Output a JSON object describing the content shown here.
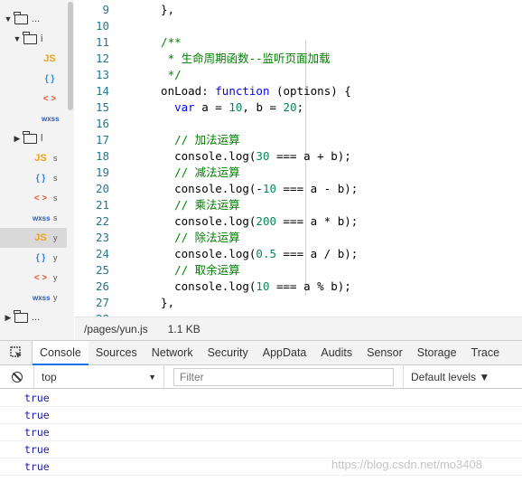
{
  "file_tree": {
    "rows": [
      {
        "arrow": "▼",
        "type": "folder",
        "name": "..."
      },
      {
        "arrow": "▼",
        "type": "folder",
        "name": "i"
      },
      {
        "type": "file",
        "icon": "JS",
        "icon_kind": "js",
        "name": ""
      },
      {
        "type": "file",
        "icon": "{ }",
        "icon_kind": "json",
        "name": ""
      },
      {
        "type": "file",
        "icon": "< >",
        "icon_kind": "wxml",
        "name": ""
      },
      {
        "type": "file",
        "icon": "wxss",
        "icon_kind": "wxss",
        "name": ""
      },
      {
        "arrow": "▶",
        "type": "folder",
        "name": "l"
      },
      {
        "type": "file",
        "icon": "JS",
        "icon_kind": "js",
        "name": "s"
      },
      {
        "type": "file",
        "icon": "{ }",
        "icon_kind": "json",
        "name": "s"
      },
      {
        "type": "file",
        "icon": "< >",
        "icon_kind": "wxml",
        "name": "s"
      },
      {
        "type": "file",
        "icon": "wxss",
        "icon_kind": "wxss",
        "name": "s"
      },
      {
        "type": "file",
        "icon": "JS",
        "icon_kind": "js",
        "name": "y",
        "selected": true
      },
      {
        "type": "file",
        "icon": "{ }",
        "icon_kind": "json",
        "name": "y"
      },
      {
        "type": "file",
        "icon": "< >",
        "icon_kind": "wxml",
        "name": "y"
      },
      {
        "type": "file",
        "icon": "wxss",
        "icon_kind": "wxss",
        "name": "y"
      },
      {
        "arrow": "▶",
        "type": "folder",
        "name": "..."
      }
    ]
  },
  "editor": {
    "lines": [
      {
        "n": "9",
        "tokens": [
          [
            "plain",
            "  },"
          ]
        ]
      },
      {
        "n": "10",
        "tokens": []
      },
      {
        "n": "11",
        "tokens": [
          [
            "com",
            "  /**"
          ]
        ]
      },
      {
        "n": "12",
        "tokens": [
          [
            "com",
            "   * 生命周期函数--监听页面加载"
          ]
        ]
      },
      {
        "n": "13",
        "tokens": [
          [
            "com",
            "   */"
          ]
        ]
      },
      {
        "n": "14",
        "tokens": [
          [
            "plain",
            "  onLoad: "
          ],
          [
            "kw",
            "function"
          ],
          [
            "plain",
            " (options) {"
          ]
        ]
      },
      {
        "n": "15",
        "tokens": [
          [
            "plain",
            "    "
          ],
          [
            "kw",
            "var"
          ],
          [
            "plain",
            " a = "
          ],
          [
            "num",
            "10"
          ],
          [
            "plain",
            ", b = "
          ],
          [
            "num",
            "20"
          ],
          [
            "plain",
            ";"
          ]
        ]
      },
      {
        "n": "16",
        "tokens": []
      },
      {
        "n": "17",
        "tokens": [
          [
            "com",
            "    // 加法运算"
          ]
        ]
      },
      {
        "n": "18",
        "tokens": [
          [
            "plain",
            "    console.log("
          ],
          [
            "num",
            "30"
          ],
          [
            "plain",
            " === a + b);"
          ]
        ]
      },
      {
        "n": "19",
        "tokens": [
          [
            "com",
            "    // 减法运算"
          ]
        ]
      },
      {
        "n": "20",
        "tokens": [
          [
            "plain",
            "    console.log(-"
          ],
          [
            "num",
            "10"
          ],
          [
            "plain",
            " === a - b);"
          ]
        ]
      },
      {
        "n": "21",
        "tokens": [
          [
            "com",
            "    // 乘法运算"
          ]
        ]
      },
      {
        "n": "22",
        "tokens": [
          [
            "plain",
            "    console.log("
          ],
          [
            "num",
            "200"
          ],
          [
            "plain",
            " === a * b);"
          ]
        ]
      },
      {
        "n": "23",
        "tokens": [
          [
            "com",
            "    // 除法运算"
          ]
        ]
      },
      {
        "n": "24",
        "tokens": [
          [
            "plain",
            "    console.log("
          ],
          [
            "num",
            "0.5"
          ],
          [
            "plain",
            " === a / b);"
          ]
        ]
      },
      {
        "n": "25",
        "tokens": [
          [
            "com",
            "    // 取余运算"
          ]
        ]
      },
      {
        "n": "26",
        "tokens": [
          [
            "plain",
            "    console.log("
          ],
          [
            "num",
            "10"
          ],
          [
            "plain",
            " === a % b);"
          ]
        ]
      },
      {
        "n": "27",
        "tokens": [
          [
            "plain",
            "  },"
          ]
        ]
      },
      {
        "n": "28",
        "tokens": []
      }
    ]
  },
  "status_bar": {
    "path": "/pages/yun.js",
    "size": "1.1 KB"
  },
  "devtools": {
    "tabs": [
      "Console",
      "Sources",
      "Network",
      "Security",
      "AppData",
      "Audits",
      "Sensor",
      "Storage",
      "Trace"
    ],
    "active_tab": "Console",
    "context": "top",
    "filter_placeholder": "Filter",
    "levels": "Default levels ▼",
    "console_output": [
      "true",
      "true",
      "true",
      "true",
      "true"
    ]
  },
  "watermark": "https://blog.csdn.net/mo3408",
  "colors": {
    "keyword": "#0000ff",
    "number": "#098658",
    "comment": "#008000",
    "line_number": "#237893",
    "console_value": "#1a1aa6",
    "active_tab_underline": "#1a73e8"
  }
}
